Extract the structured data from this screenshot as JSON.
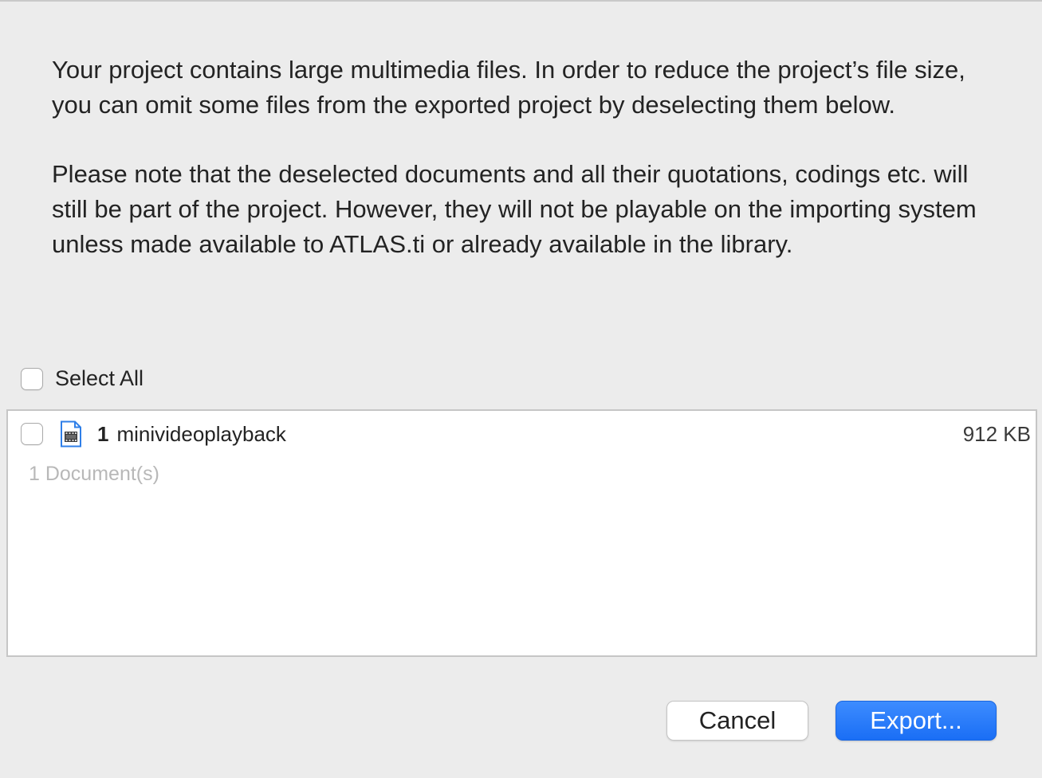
{
  "dialog": {
    "message_paragraph_1": "Your project contains large multimedia files. In order to reduce the project’s file size, you can omit some files from the exported project by deselecting them below.",
    "message_paragraph_2": "Please note that the deselected documents and all their quotations, codings etc. will still be part of the project. However, they will not be playable on the importing system unless made available to ATLAS.ti or already available in the library.",
    "select_all": {
      "label": "Select All",
      "checked": false
    },
    "documents": [
      {
        "number": "1",
        "name": "minivideoplayback",
        "size": "912 KB",
        "checked": false,
        "icon": "video-document-icon"
      }
    ],
    "document_count": "1 Document(s)",
    "buttons": {
      "cancel": "Cancel",
      "export": "Export..."
    }
  },
  "colors": {
    "background": "#ececec",
    "accent": "#1a6ef5",
    "icon_blue": "#2f7fe8"
  }
}
